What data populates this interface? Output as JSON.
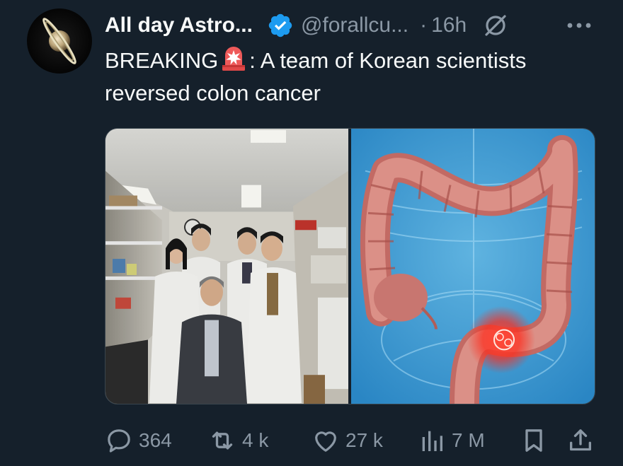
{
  "post": {
    "display_name": "All day Astro...",
    "handle": "@forallcu...",
    "separator": "·",
    "time": "16h",
    "text_before": "BREAKING",
    "text_after": ": A team of Korean scientists reversed colon cancer"
  },
  "icons": {
    "avatar": "saturn-avatar",
    "verified": "verified-badge-icon",
    "grok": "grok-icon",
    "more": "more-icon",
    "siren": "rotating-light-emoji",
    "reply": "reply-icon",
    "retweet": "retweet-icon",
    "like": "heart-icon",
    "views": "views-icon",
    "bookmark": "bookmark-icon",
    "share": "share-icon"
  },
  "actions": {
    "replies": "364",
    "reposts": "4 k",
    "likes": "27 k",
    "views": "7 M"
  },
  "colors": {
    "background": "#15202b",
    "text": "#e7e9ea",
    "secondary": "#8b98a5",
    "verified": "#1d9bf0"
  }
}
